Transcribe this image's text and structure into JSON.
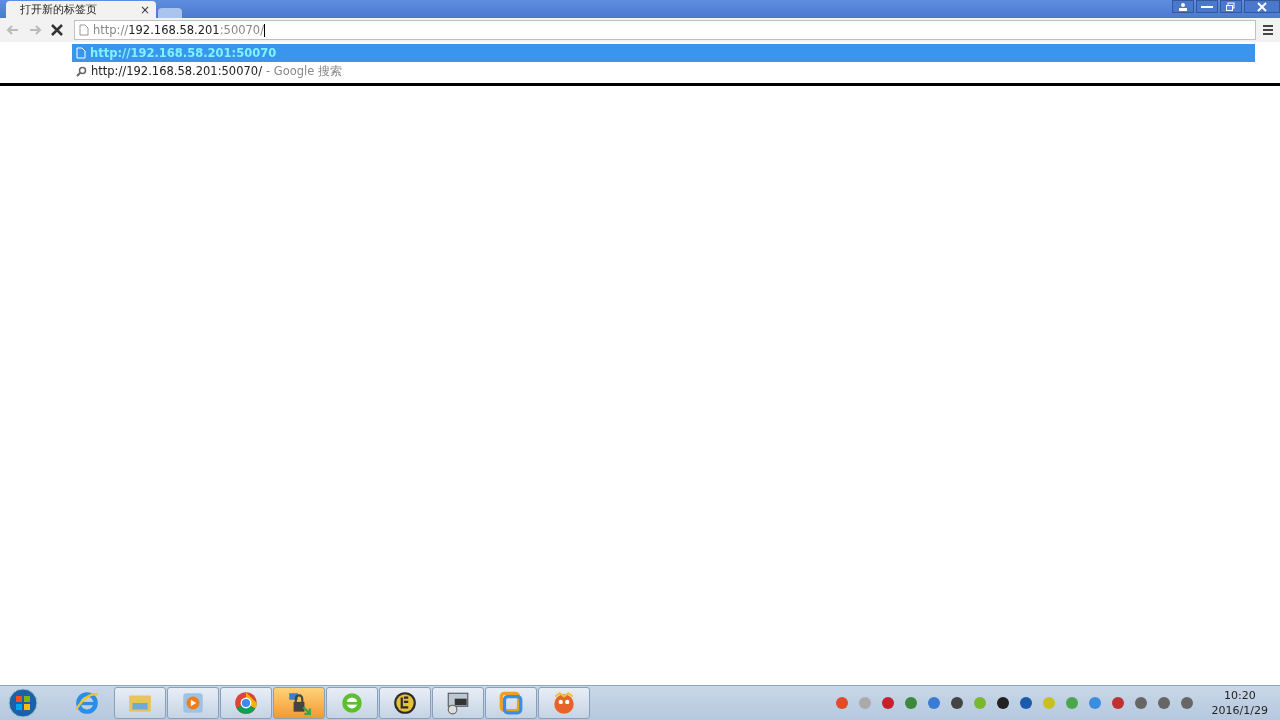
{
  "tabs": [
    {
      "title": "打开新的标签页",
      "close": "×",
      "selected": true
    },
    {
      "selected": false
    }
  ],
  "toolbar": {
    "back_disabled": true,
    "forward_disabled": true,
    "address_parts": [
      {
        "text": "http://",
        "dim": true
      },
      {
        "text": "192.168.58.201",
        "dim": false
      },
      {
        "text": ":50070/",
        "dim": true
      }
    ]
  },
  "suggestions": [
    {
      "kind": "page",
      "text": "http://192.168.58.201:50070",
      "selected": true
    },
    {
      "kind": "search",
      "text": "http://192.168.58.201:50070/",
      "hint": "- Google 搜索",
      "selected": false
    }
  ],
  "taskbar": {
    "pinned": [
      {
        "kind": "ie",
        "framed": false,
        "highlighted": false
      },
      {
        "kind": "folder",
        "framed": true,
        "highlighted": false
      },
      {
        "kind": "media",
        "framed": true,
        "highlighted": false
      },
      {
        "kind": "chrome",
        "framed": true,
        "highlighted": false
      },
      {
        "kind": "lock",
        "framed": true,
        "highlighted": true
      },
      {
        "kind": "ie-green",
        "framed": true,
        "highlighted": false
      },
      {
        "kind": "editor",
        "framed": true,
        "highlighted": false
      },
      {
        "kind": "scanner",
        "framed": true,
        "highlighted": false
      },
      {
        "kind": "vm",
        "framed": true,
        "highlighted": false
      },
      {
        "kind": "game",
        "framed": true,
        "highlighted": false
      }
    ],
    "time": "10:20",
    "date": "2016/1/29"
  }
}
